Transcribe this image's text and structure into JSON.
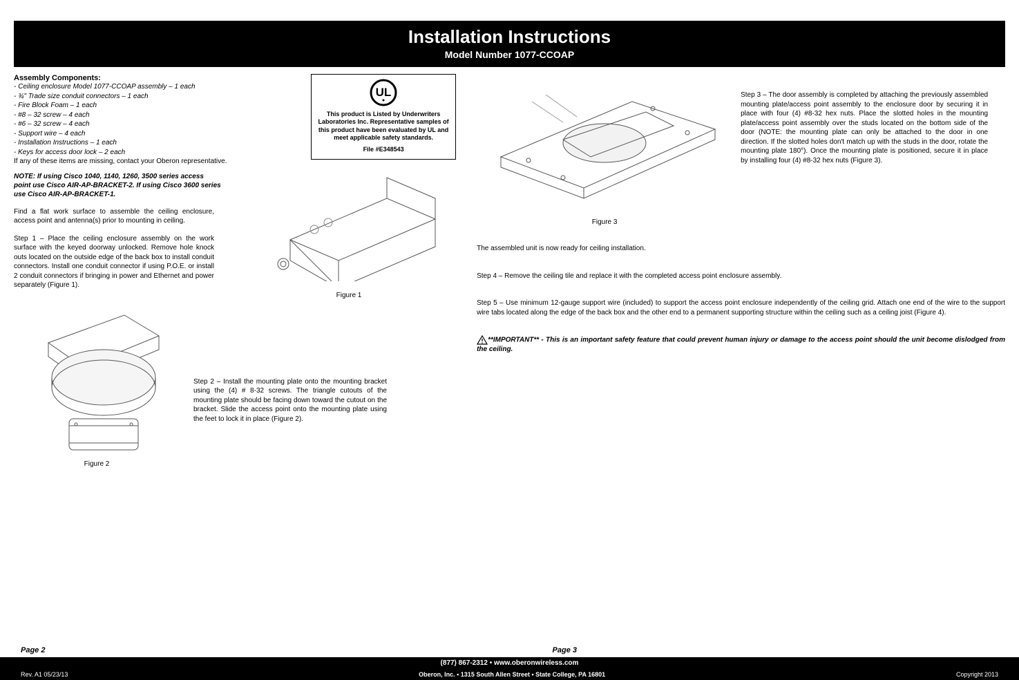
{
  "header": {
    "title": "Installation Instructions",
    "subtitle": "Model Number 1077-CCOAP"
  },
  "assembly": {
    "heading": "Assembly Components:",
    "items": [
      "- Ceiling enclosure Model 1077-CCOAP assembly – 1 each",
      "- ¾\" Trade size conduit connectors – 1 each",
      "- Fire Block Foam – 1 each",
      "- #8 – 32 screw – 4 each",
      "- #6 – 32 screw – 4 each",
      "- Support wire – 4 each",
      "- Installation Instructions – 1 each",
      "- Keys for access door lock – 2 each"
    ],
    "missing": "If any of these items are missing, contact your Oberon representative."
  },
  "note": "NOTE: If using Cisco 1040, 1140, 1260, 3500 series access point use Cisco AIR-AP-BRACKET-2. If using Cisco 3600 series use Cisco AIR-AP-BRACKET-1.",
  "intro": "Find a flat work surface to assemble the ceiling enclosure, access point and antenna(s) prior to mounting in ceiling.",
  "step1": "Step 1 – Place the ceiling enclosure assembly on the work surface with the keyed doorway unlocked. Remove hole knock outs located on the outside edge of the back box to install conduit connectors. Install one conduit connector if using P.O.E. or install 2 conduit connectors if bringing in power and Ethernet and power separately (Figure 1).",
  "step2": "Step 2 – Install the mounting plate onto the mounting bracket using the (4) # 8-32 screws. The triangle cutouts of the mounting plate should be facing down toward the cutout on the bracket. Slide the access point onto the mounting plate using the feet to lock it in place (Figure 2).",
  "step3": "Step 3 – The door assembly is completed by attaching the previously assembled mounting plate/access point assembly to the enclosure door by securing it in place with four (4) #8-32 hex nuts. Place the slotted holes in the mounting plate/access point assembly over the studs located on the bottom side of the door (NOTE: the mounting plate can only be attached to the door in one direction. If the slotted holes don't match up with the studs in the door, rotate the mounting plate 180°). Once the mounting plate is positioned, secure it in place by installing four (4) #8-32 hex nuts (Figure 3).",
  "assembled": "The assembled unit is now ready for ceiling installation.",
  "step4": "Step 4 – Remove the ceiling tile and replace it with the completed access point enclosure assembly.",
  "step5": "Step 5 – Use minimum 12-gauge support wire (included) to support the access point enclosure independently of the ceiling grid. Attach one end of the wire to the support wire tabs located along the edge of the back box and the other end to a permanent supporting structure within the ceiling such as a ceiling joist (Figure 4).",
  "important": "**IMPORTANT** - This is an important safety feature that could prevent human injury or damage to the access point should the unit become dislodged from the ceiling.",
  "ul_box": {
    "line1": "This product is Listed by Underwriters Laboratories Inc. Representative samples of this product have been evaluated by UL and meet applicable safety standards.",
    "file": "File #E348543"
  },
  "figures": {
    "f1": "Figure 1",
    "f2": "Figure 2",
    "f3": "Figure 3"
  },
  "footer": {
    "page2": "Page 2",
    "page3": "Page 3",
    "bar1": "(877) 867-2312  •  www.oberonwireless.com",
    "rev": "Rev. A1 05/23/13",
    "addr": "Oberon, Inc.  •  1315 South Allen Street  •  State College, PA 16801",
    "copy": "Copyright 2013"
  }
}
